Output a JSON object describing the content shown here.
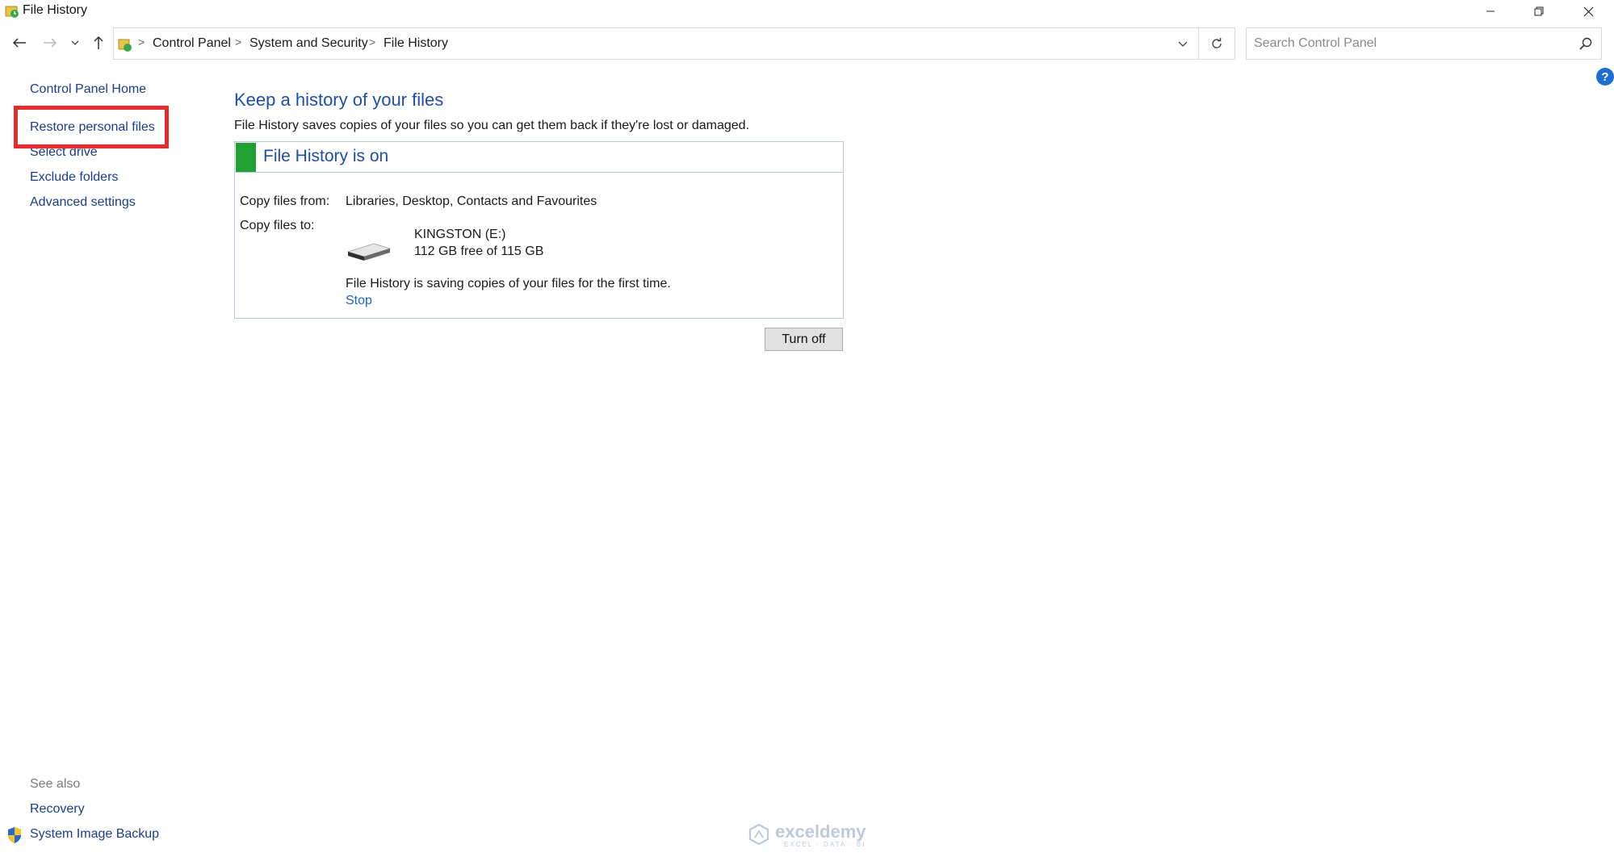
{
  "window": {
    "title": "File History",
    "icons": [
      "file-history-icon",
      "minimize-icon",
      "restore-icon",
      "close-icon"
    ]
  },
  "nav": {
    "breadcrumbs": [
      "Control Panel",
      "System and Security",
      "File History"
    ],
    "search_placeholder": "Search Control Panel",
    "icons": [
      "back-arrow-icon",
      "forward-arrow-icon",
      "chevron-down-icon",
      "up-arrow-icon",
      "refresh-icon",
      "search-icon"
    ]
  },
  "sidebar": {
    "links": [
      "Control Panel Home",
      "Restore personal files",
      "Select drive",
      "Exclude folders",
      "Advanced settings"
    ],
    "highlighted": "Restore personal files",
    "highlight_color": "#e52b2b",
    "see_also_label": "See also",
    "see_also_links": [
      "Recovery",
      "System Image Backup"
    ]
  },
  "main": {
    "title": "Keep a history of your files",
    "description": "File History saves copies of your files so you can get them back if they're lost or damaged.",
    "status": {
      "title": "File History is on",
      "indicator_color": "#21a034",
      "copy_from_label": "Copy files from:",
      "copy_from_value": "Libraries, Desktop, Contacts and Favourites",
      "copy_to_label": "Copy files to:",
      "drive_name": "KINGSTON (E:)",
      "drive_space": "112 GB free of 115 GB",
      "saving_message": "File History is saving copies of your files for the first time.",
      "stop_label": "Stop"
    },
    "turn_off_label": "Turn off"
  },
  "watermark": {
    "name": "exceldemy",
    "tagline": "EXCEL · DATA · BI"
  }
}
